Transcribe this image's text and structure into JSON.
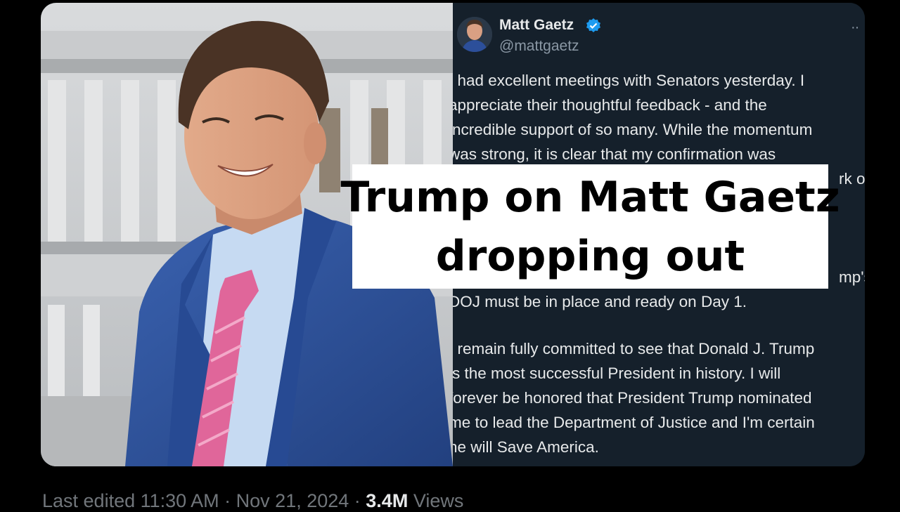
{
  "headline": {
    "line1": "Trump on Matt Gaetz",
    "line2": "dropping out"
  },
  "tweet": {
    "author_name": "Matt Gaetz",
    "handle": "@mattgaetz",
    "lines": [
      "I had excellent meetings with Senators yesterday.  I",
      "appreciate their thoughtful feedback - and the",
      "incredible support of so many.  While the momentum",
      "was strong, it is clear that my confirmation was",
      "rk of",
      "mp's",
      "DOJ must be in place and ready on Day 1.",
      "I remain fully committed to see that Donald J. Trump",
      "is the most successful President in history.  I will",
      "forever be honored that President Trump nominated",
      "me to lead the Department of Justice and I'm certain",
      "he will Save America."
    ]
  },
  "footer": {
    "edited_label": "Last edited 11:30 AM · Nov 21, 2024 · ",
    "views_count": "3.4M",
    "views_label": " Views"
  },
  "colors": {
    "tweet_bg": "#15202b",
    "tweet_text": "#e7e9ea",
    "handle_text": "#8b98a5",
    "verified_blue": "#1d9bf0",
    "suit_blue": "#2c4f9a",
    "tie_pink": "#e0669a"
  },
  "icons": {
    "verified": "verified-badge-icon",
    "more": "more-options-icon"
  }
}
